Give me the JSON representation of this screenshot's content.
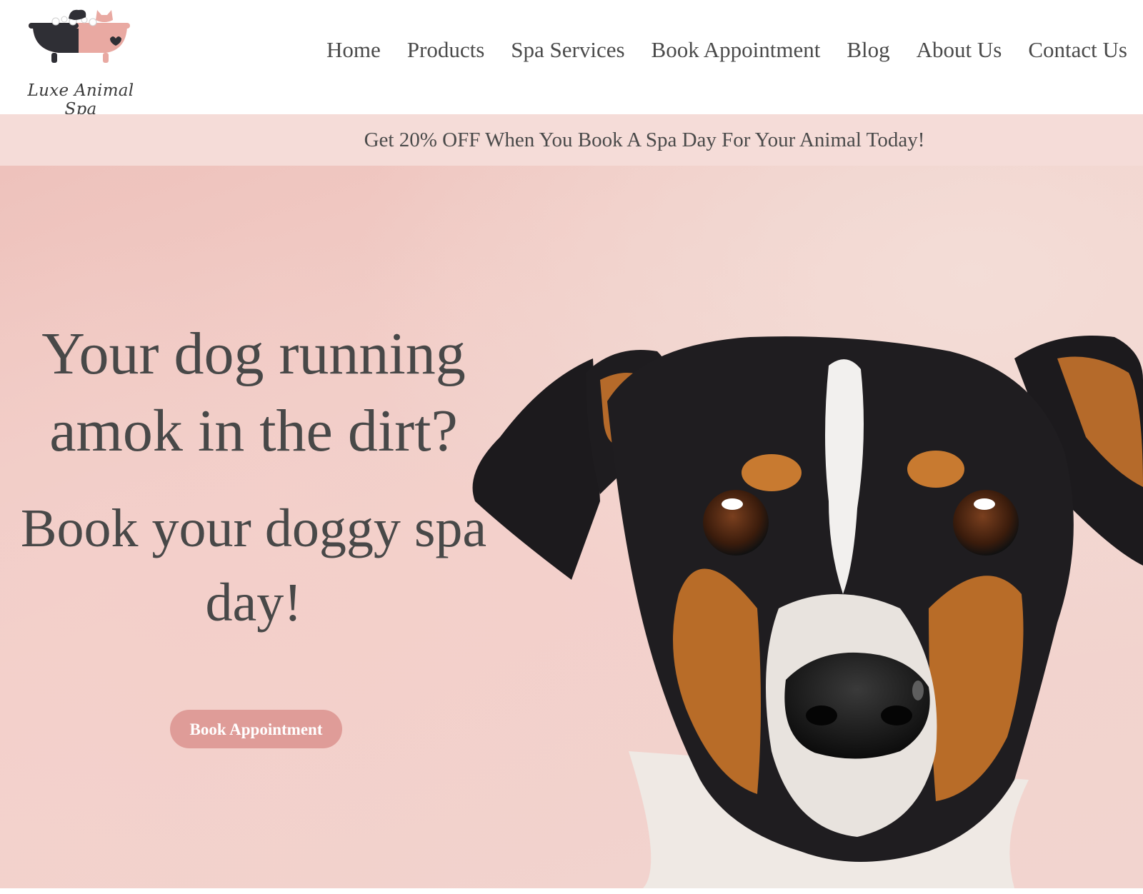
{
  "brand": {
    "name": "Luxe Animal Spa",
    "logo_icon": "clawfoot-bathtub-with-pets-icon"
  },
  "nav": {
    "items": [
      {
        "label": "Home"
      },
      {
        "label": "Products"
      },
      {
        "label": "Spa Services"
      },
      {
        "label": "Book Appointment"
      },
      {
        "label": "Blog"
      },
      {
        "label": "About Us"
      },
      {
        "label": "Contact Us"
      }
    ]
  },
  "promo": {
    "text": "Get 20% OFF When You Book A Spa Day For Your Animal Today!"
  },
  "hero": {
    "heading": "Your dog running amok in the dirt?",
    "subheading": "Book your doggy spa day!",
    "cta_label": "Book Appointment",
    "image": "tricolor-jack-russell-dog-face-photo"
  },
  "colors": {
    "accent": "#df9c98",
    "promo_background": "#f5dcd8",
    "hero_background": "#f2d0ca",
    "text": "#4a4a4a"
  }
}
